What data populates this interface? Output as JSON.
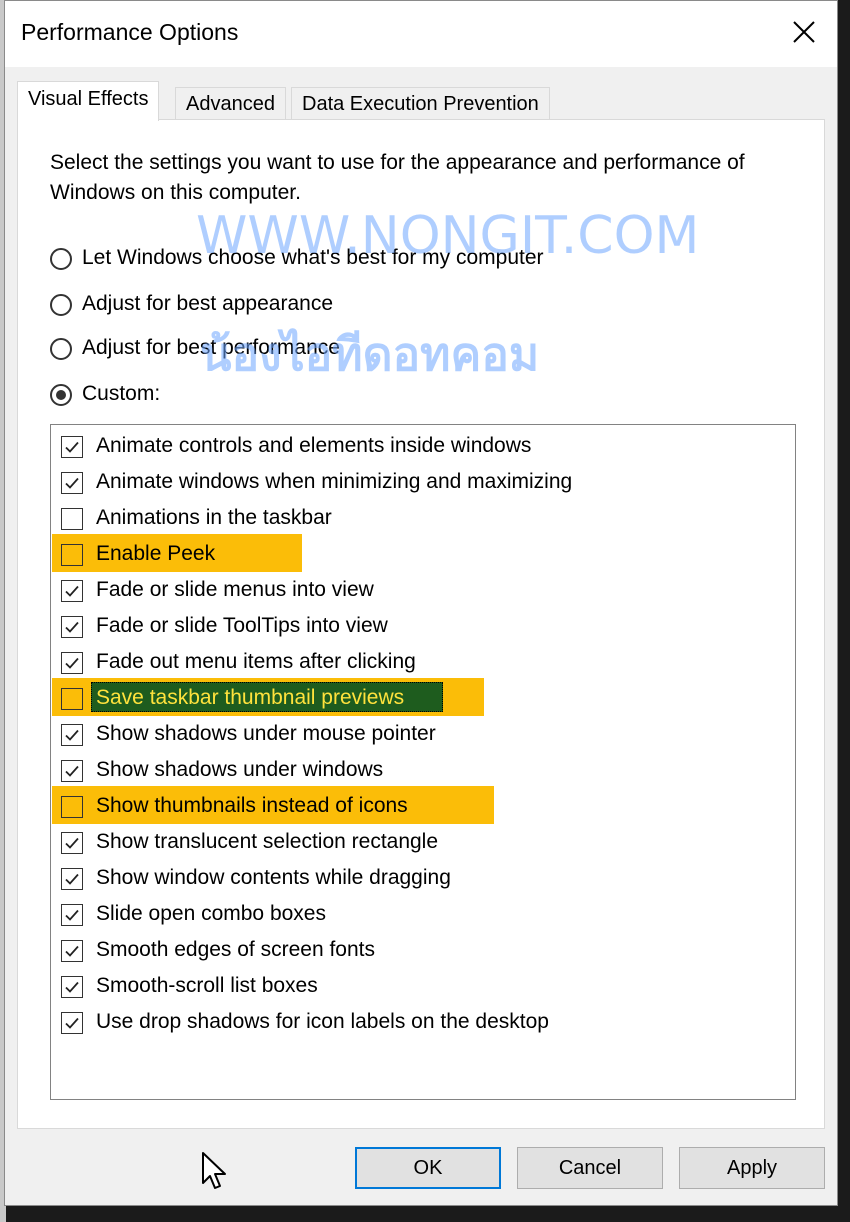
{
  "window": {
    "title": "Performance Options",
    "close_icon": "close-icon"
  },
  "tabs": [
    {
      "label": "Visual Effects",
      "active": true
    },
    {
      "label": "Advanced",
      "active": false
    },
    {
      "label": "Data Execution Prevention",
      "active": false
    }
  ],
  "description": "Select the settings you want to use for the appearance and performance of Windows on this computer.",
  "radios": [
    {
      "label": "Let Windows choose what's best for my computer",
      "checked": false
    },
    {
      "label": "Adjust for best appearance",
      "checked": false
    },
    {
      "label": "Adjust for best performance",
      "checked": false
    },
    {
      "label": "Custom:",
      "checked": true
    }
  ],
  "effects": [
    {
      "label": "Animate controls and elements inside windows",
      "checked": true,
      "highlighted": false
    },
    {
      "label": "Animate windows when minimizing and maximizing",
      "checked": true,
      "highlighted": false
    },
    {
      "label": "Animations in the taskbar",
      "checked": false,
      "highlighted": false
    },
    {
      "label": "Enable Peek",
      "checked": false,
      "highlighted": true
    },
    {
      "label": "Fade or slide menus into view",
      "checked": true,
      "highlighted": false
    },
    {
      "label": "Fade or slide ToolTips into view",
      "checked": true,
      "highlighted": false
    },
    {
      "label": "Fade out menu items after clicking",
      "checked": true,
      "highlighted": false
    },
    {
      "label": "Save taskbar thumbnail previews",
      "checked": false,
      "highlighted": true,
      "selected": true
    },
    {
      "label": "Show shadows under mouse pointer",
      "checked": true,
      "highlighted": false
    },
    {
      "label": "Show shadows under windows",
      "checked": true,
      "highlighted": false
    },
    {
      "label": "Show thumbnails instead of icons",
      "checked": false,
      "highlighted": true
    },
    {
      "label": "Show translucent selection rectangle",
      "checked": true,
      "highlighted": false
    },
    {
      "label": "Show window contents while dragging",
      "checked": true,
      "highlighted": false
    },
    {
      "label": "Slide open combo boxes",
      "checked": true,
      "highlighted": false
    },
    {
      "label": "Smooth edges of screen fonts",
      "checked": true,
      "highlighted": false
    },
    {
      "label": "Smooth-scroll list boxes",
      "checked": true,
      "highlighted": false
    },
    {
      "label": "Use drop shadows for icon labels on the desktop",
      "checked": true,
      "highlighted": false
    }
  ],
  "watermark": {
    "line1": "WWW.NONGIT.COM",
    "line2": "น้องไอทีดอทคอม"
  },
  "buttons": {
    "ok": "OK",
    "cancel": "Cancel",
    "apply": "Apply"
  },
  "colors": {
    "highlight": "#fbbd08",
    "selection": "#1e5c1e",
    "selection_text": "#ffe23c",
    "default_button_border": "#0078d7"
  }
}
